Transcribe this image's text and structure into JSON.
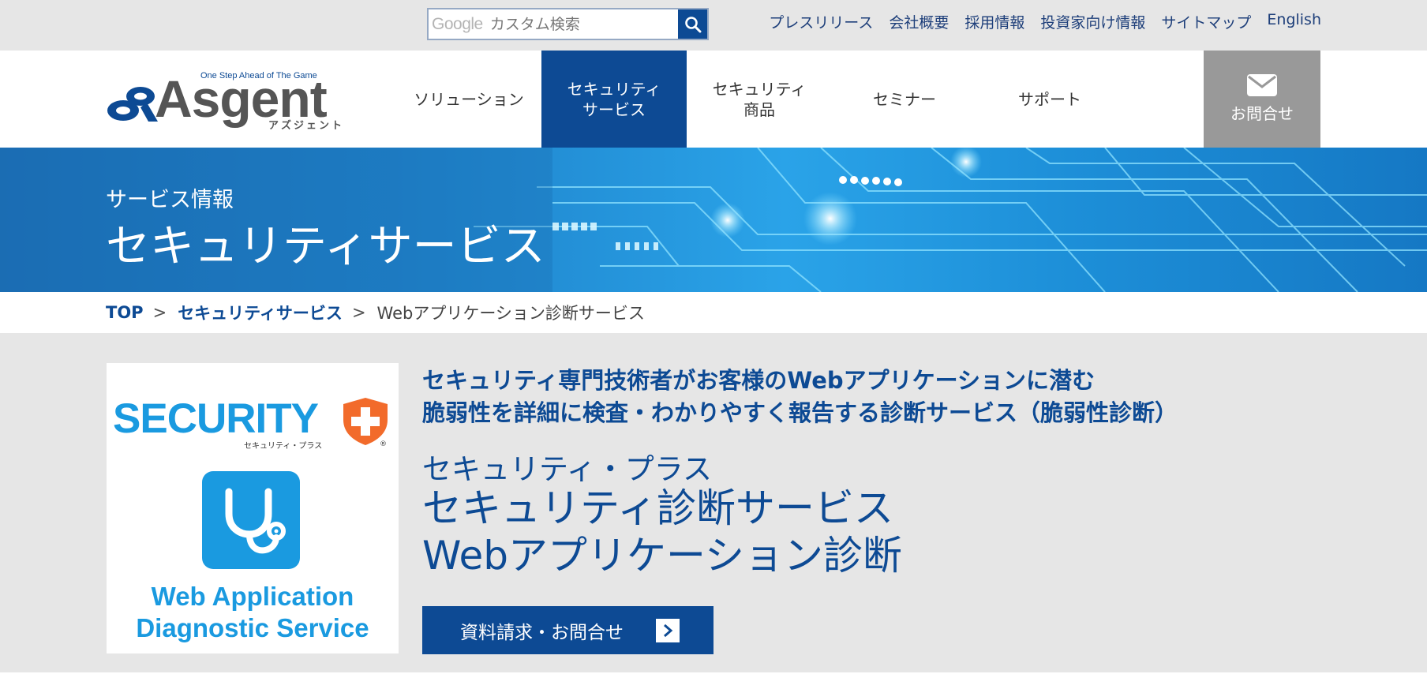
{
  "colors": {
    "brand_blue": "#0d4a94",
    "light_blue": "#1a9ae0",
    "gray_bar": "#e6e6e6",
    "contact_gray": "#999999",
    "accent_orange": "#f26b2b"
  },
  "search": {
    "logo_text": "Google",
    "placeholder": "カスタム検索",
    "button_icon": "search-icon"
  },
  "top_links": [
    "プレスリリース",
    "会社概要",
    "採用情報",
    "投資家向け情報",
    "サイトマップ",
    "English"
  ],
  "logo": {
    "tagline": "One Step Ahead of The Game",
    "wordmark": "Asgent",
    "kana": "アズジェント"
  },
  "nav": [
    {
      "label": "ソリューション",
      "active": false
    },
    {
      "label": "セキュリティ\nサービス",
      "active": true
    },
    {
      "label": "セキュリティ\n商品",
      "active": false
    },
    {
      "label": "セミナー",
      "active": false
    },
    {
      "label": "サポート",
      "active": false
    }
  ],
  "contact": {
    "label": "お問合せ",
    "icon": "envelope-icon"
  },
  "hero": {
    "subtitle": "サービス情報",
    "title": "セキュリティサービス"
  },
  "breadcrumb": {
    "items": [
      "TOP",
      "セキュリティサービス"
    ],
    "separator": ">",
    "current": "Webアプリケーション診断サービス"
  },
  "product_card": {
    "brand": "SECURITY",
    "brand_kana": "セキュリティ・プラス",
    "registered": "®",
    "icon": "stethoscope-icon",
    "caption": "Web Application\nDiagnostic Service"
  },
  "main": {
    "lead": "セキュリティ専門技術者がお客様のWebアプリケーションに潜む\n脆弱性を詳細に検査・わかりやすく報告する診断サービス（脆弱性診断）",
    "subtitle": "セキュリティ・プラス",
    "title": "セキュリティ診断サービス\nWebアプリケーション診断",
    "cta_label": "資料請求・お問合せ",
    "cta_icon": "chevron-right-icon"
  }
}
